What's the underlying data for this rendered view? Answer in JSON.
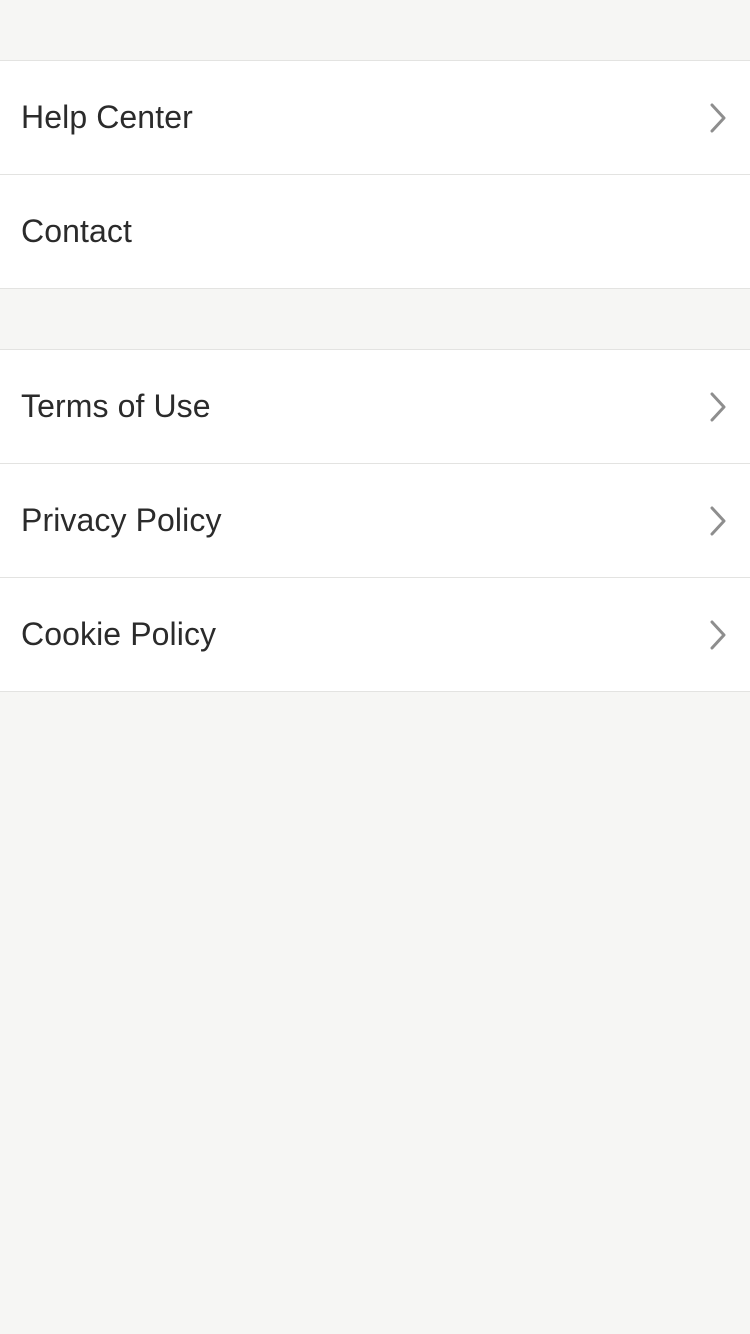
{
  "sections": [
    {
      "items": [
        {
          "label": "Help Center",
          "chevron": true,
          "icon": "chevron-right-icon"
        },
        {
          "label": "Contact",
          "chevron": false
        }
      ]
    },
    {
      "items": [
        {
          "label": "Terms of Use",
          "chevron": true,
          "icon": "chevron-right-icon"
        },
        {
          "label": "Privacy Policy",
          "chevron": true,
          "icon": "chevron-right-icon"
        },
        {
          "label": "Cookie Policy",
          "chevron": true,
          "icon": "chevron-right-icon"
        }
      ]
    }
  ],
  "colors": {
    "background": "#f6f6f4",
    "row_background": "#ffffff",
    "text": "#2b2b2b",
    "chevron": "#8e8e8e",
    "divider": "#e3e3e1"
  }
}
